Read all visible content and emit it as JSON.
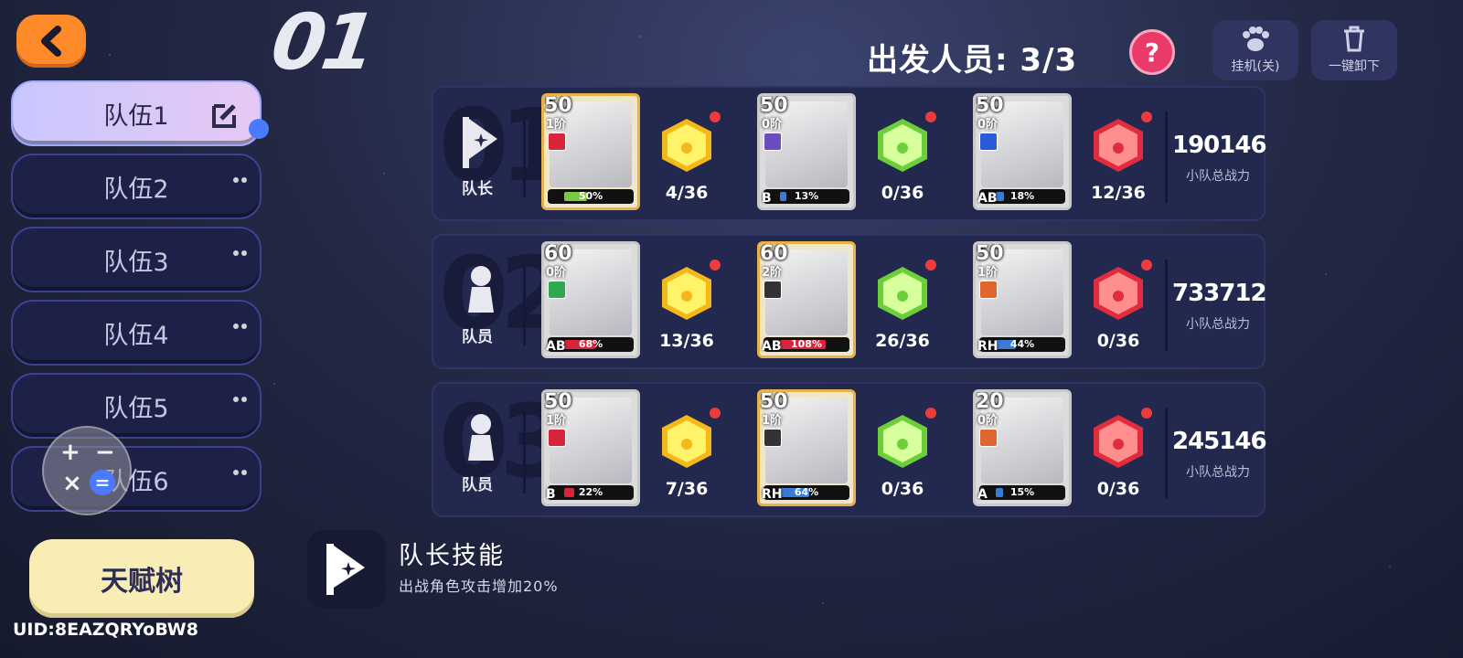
{
  "header": {
    "index": "01",
    "deploy_label": "出发人员: 3/3",
    "help": "?",
    "auto_label": "挂机(关)",
    "unload_label": "一键卸下"
  },
  "tabs": [
    {
      "label": "队伍1",
      "active": true
    },
    {
      "label": "队伍2",
      "active": false
    },
    {
      "label": "队伍3",
      "active": false
    },
    {
      "label": "队伍4",
      "active": false
    },
    {
      "label": "队伍5",
      "active": false
    },
    {
      "label": "队伍6",
      "active": false
    }
  ],
  "talent_button": "天赋树",
  "uid": "UID:8EAZQRYoBW8",
  "squads": [
    {
      "role": "队长",
      "power": "190146",
      "power_label": "小队总战力",
      "cards": [
        {
          "level": "50",
          "stage": "1阶",
          "grade": "",
          "progress": "50%",
          "fill_pct": 50,
          "bar_color": "#7ac943",
          "gem": "yellow",
          "gem_count": "4/36",
          "elem_color": "#d9253b",
          "theme": "gold"
        },
        {
          "level": "50",
          "stage": "0阶",
          "grade": "B",
          "progress": "13%",
          "fill_pct": 13,
          "bar_color": "#3a7bd5",
          "gem": "green",
          "gem_count": "0/36",
          "elem_color": "#6d4cc2",
          "theme": "silver"
        },
        {
          "level": "50",
          "stage": "0阶",
          "grade": "AB",
          "progress": "18%",
          "fill_pct": 18,
          "bar_color": "#3a7bd5",
          "gem": "red",
          "gem_count": "12/36",
          "elem_color": "#2b5bd7",
          "theme": "silver"
        }
      ]
    },
    {
      "role": "队员",
      "power": "733712",
      "power_label": "小队总战力",
      "cards": [
        {
          "level": "60",
          "stage": "0阶",
          "grade": "AB",
          "progress": "68%",
          "fill_pct": 68,
          "bar_color": "#d9253b",
          "gem": "yellow",
          "gem_count": "13/36",
          "elem_color": "#2fa84f",
          "theme": "silver"
        },
        {
          "level": "60",
          "stage": "2阶",
          "grade": "AB",
          "progress": "108%",
          "fill_pct": 100,
          "bar_color": "#d9253b",
          "gem": "green",
          "gem_count": "26/36",
          "elem_color": "#333333",
          "theme": "gold"
        },
        {
          "level": "50",
          "stage": "1阶",
          "grade": "RH",
          "progress": "44%",
          "fill_pct": 44,
          "bar_color": "#3a7bd5",
          "gem": "red",
          "gem_count": "0/36",
          "elem_color": "#e0662b",
          "theme": "silver"
        }
      ]
    },
    {
      "role": "队员",
      "power": "245146",
      "power_label": "小队总战力",
      "cards": [
        {
          "level": "50",
          "stage": "1阶",
          "grade": "B",
          "progress": "22%",
          "fill_pct": 22,
          "bar_color": "#d9253b",
          "gem": "yellow",
          "gem_count": "7/36",
          "elem_color": "#d9253b",
          "theme": "silver"
        },
        {
          "level": "50",
          "stage": "1阶",
          "grade": "RH",
          "progress": "64%",
          "fill_pct": 64,
          "bar_color": "#3a7bd5",
          "gem": "green",
          "gem_count": "0/36",
          "elem_color": "#333333",
          "theme": "gold"
        },
        {
          "level": "20",
          "stage": "0阶",
          "grade": "A",
          "progress": "15%",
          "fill_pct": 15,
          "bar_color": "#3a7bd5",
          "gem": "red",
          "gem_count": "0/36",
          "elem_color": "#e0662b",
          "theme": "silver"
        }
      ]
    }
  ],
  "leader_skill": {
    "title": "队长技能",
    "desc": "出战角色攻击增加20%"
  },
  "colors": {
    "accent_orange": "#ff8a2a",
    "help_pink": "#e93a6a",
    "tab_active": "#c9c7ff",
    "talent_bg": "#f8edb4"
  }
}
